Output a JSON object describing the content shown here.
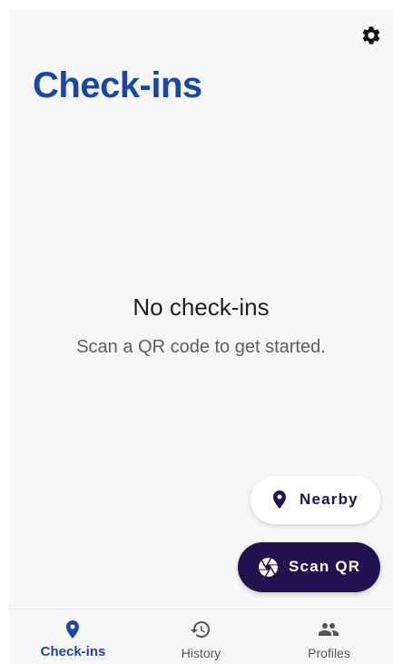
{
  "header": {
    "title": "Check-ins",
    "settings_icon": "gear-icon"
  },
  "empty_state": {
    "title": "No check-ins",
    "subtitle": "Scan a QR code to get started."
  },
  "actions": {
    "nearby": {
      "label": "Nearby",
      "icon": "location-pin-icon"
    },
    "scan_qr": {
      "label": "Scan QR",
      "icon": "camera-shutter-icon"
    }
  },
  "bottom_nav": {
    "items": [
      {
        "label": "Check-ins",
        "icon": "location-pin-icon",
        "active": true
      },
      {
        "label": "History",
        "icon": "history-icon",
        "active": false
      },
      {
        "label": "Profiles",
        "icon": "people-icon",
        "active": false
      }
    ]
  },
  "colors": {
    "accent": "#1a47a6",
    "primary_dark": "#22124f",
    "background": "#f7f7f7",
    "inactive": "#555555"
  }
}
